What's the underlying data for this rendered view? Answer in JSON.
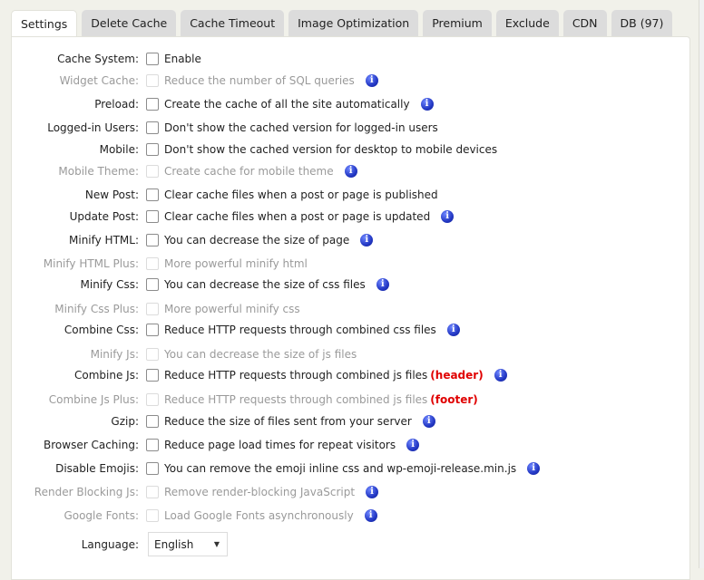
{
  "tabs": [
    {
      "label": "Settings",
      "active": true
    },
    {
      "label": "Delete Cache"
    },
    {
      "label": "Cache Timeout"
    },
    {
      "label": "Image Optimization"
    },
    {
      "label": "Premium"
    },
    {
      "label": "Exclude"
    },
    {
      "label": "CDN"
    },
    {
      "label": "DB (97)"
    }
  ],
  "settings": [
    {
      "label": "Cache System:",
      "desc": "Enable",
      "disabled": false,
      "info": false,
      "checked": false
    },
    {
      "label": "Widget Cache:",
      "desc": "Reduce the number of SQL queries",
      "disabled": true,
      "info": true,
      "checked": false
    },
    {
      "label": "Preload:",
      "desc": "Create the cache of all the site automatically",
      "disabled": false,
      "info": true,
      "checked": false
    },
    {
      "label": "Logged-in Users:",
      "desc": "Don't show the cached version for logged-in users",
      "disabled": false,
      "info": false,
      "checked": false
    },
    {
      "label": "Mobile:",
      "desc": "Don't show the cached version for desktop to mobile devices",
      "disabled": false,
      "info": false,
      "checked": false
    },
    {
      "label": "Mobile Theme:",
      "desc": "Create cache for mobile theme",
      "disabled": true,
      "info": true,
      "checked": false
    },
    {
      "label": "New Post:",
      "desc": "Clear cache files when a post or page is published",
      "disabled": false,
      "info": false,
      "checked": false
    },
    {
      "label": "Update Post:",
      "desc": "Clear cache files when a post or page is updated",
      "disabled": false,
      "info": true,
      "checked": false
    },
    {
      "label": "Minify HTML:",
      "desc": "You can decrease the size of page",
      "disabled": false,
      "info": true,
      "checked": false
    },
    {
      "label": "Minify HTML Plus:",
      "desc": "More powerful minify html",
      "disabled": true,
      "info": false,
      "checked": false
    },
    {
      "label": "Minify Css:",
      "desc": "You can decrease the size of css files",
      "disabled": false,
      "info": true,
      "checked": false
    },
    {
      "label": "Minify Css Plus:",
      "desc": "More powerful minify css",
      "disabled": true,
      "info": false,
      "checked": false
    },
    {
      "label": "Combine Css:",
      "desc": "Reduce HTTP requests through combined css files",
      "disabled": false,
      "info": true,
      "checked": false
    },
    {
      "label": "Minify Js:",
      "desc": "You can decrease the size of js files",
      "disabled": true,
      "info": false,
      "checked": false
    },
    {
      "label": "Combine Js:",
      "desc": "Reduce HTTP requests through combined js files",
      "note": "(header)",
      "disabled": false,
      "info": true,
      "checked": false
    },
    {
      "label": "Combine Js Plus:",
      "desc": "Reduce HTTP requests through combined js files",
      "note": "(footer)",
      "disabled": true,
      "info": false,
      "checked": false
    },
    {
      "label": "Gzip:",
      "desc": "Reduce the size of files sent from your server",
      "disabled": false,
      "info": true,
      "checked": false
    },
    {
      "label": "Browser Caching:",
      "desc": "Reduce page load times for repeat visitors",
      "disabled": false,
      "info": true,
      "checked": false
    },
    {
      "label": "Disable Emojis:",
      "desc": "You can remove the emoji inline css and wp-emoji-release.min.js",
      "disabled": false,
      "info": true,
      "checked": false
    },
    {
      "label": "Render Blocking Js:",
      "desc": "Remove render-blocking JavaScript",
      "disabled": true,
      "info": true,
      "checked": false
    },
    {
      "label": "Google Fonts:",
      "desc": "Load Google Fonts asynchronously",
      "disabled": true,
      "info": true,
      "checked": false
    }
  ],
  "language": {
    "label": "Language:",
    "selected": "English"
  },
  "icons": {
    "info": "i",
    "dropdown_arrow": "▼"
  },
  "colors": {
    "note_red": "#e00000",
    "info_blue": "#2338c4"
  }
}
